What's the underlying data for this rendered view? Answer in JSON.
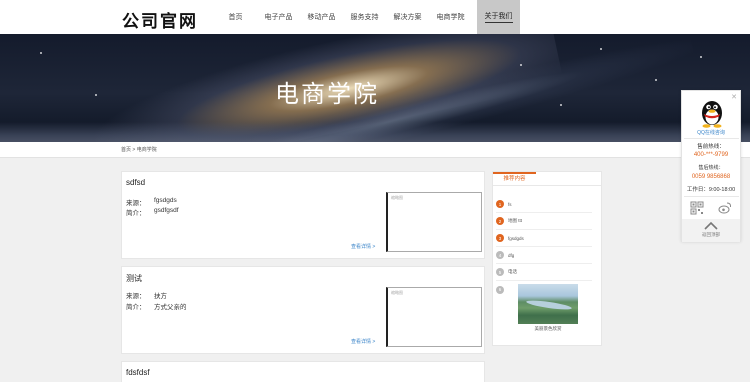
{
  "header": {
    "logo": "公司官网",
    "nav": [
      "首页",
      "电子产品",
      "移动产品",
      "服务支持",
      "解决方案",
      "电商学院",
      "关于我们"
    ],
    "active_index": 6
  },
  "banner": {
    "title": "电商学院"
  },
  "breadcrumb": {
    "home": "首页",
    "separator": ">",
    "current": "电商学院"
  },
  "articles": [
    {
      "title": "sdfsd",
      "source_label": "来源：",
      "source": "fgsdgds",
      "intro_label": "简介：",
      "intro": "gsdfgsdf",
      "more": "查看详情 >",
      "thumb": "缩略图"
    },
    {
      "title": "测试",
      "source_label": "来源：",
      "source": "扶方",
      "intro_label": "简介：",
      "intro": "方式父亲的",
      "more": "查看详情 >",
      "thumb": "缩略图"
    },
    {
      "title": "fdsfdsf"
    }
  ],
  "recommend": {
    "tab": "推荐内容",
    "items": [
      {
        "num": "1",
        "label": "fs",
        "hot": true
      },
      {
        "num": "2",
        "label": "地图 ttt",
        "hot": true
      },
      {
        "num": "3",
        "label": "fgsdgds",
        "hot": true
      },
      {
        "num": "4",
        "label": "dfg",
        "hot": false
      },
      {
        "num": "5",
        "label": "电话",
        "hot": false
      },
      {
        "num": "6",
        "label": "",
        "hot": false
      }
    ],
    "image_caption": "美丽景色欣赏"
  },
  "service": {
    "qq_label": "QQ在线咨询",
    "hotline_label": "售前热线：",
    "hotline": "400-***-9799",
    "after_label": "售后热线：",
    "after_phone": "0059 9856868",
    "hours": "工作日：9:00-18:00",
    "top_label": "返回顶部",
    "icons": [
      "qrcode-icon",
      "weibo-icon",
      "chevron-up-icon"
    ]
  },
  "colors": {
    "accent": "#e0651f",
    "link": "#3a84c9",
    "nav_active_bg": "#c8c8c8",
    "page_bg": "#f0f0f0"
  }
}
